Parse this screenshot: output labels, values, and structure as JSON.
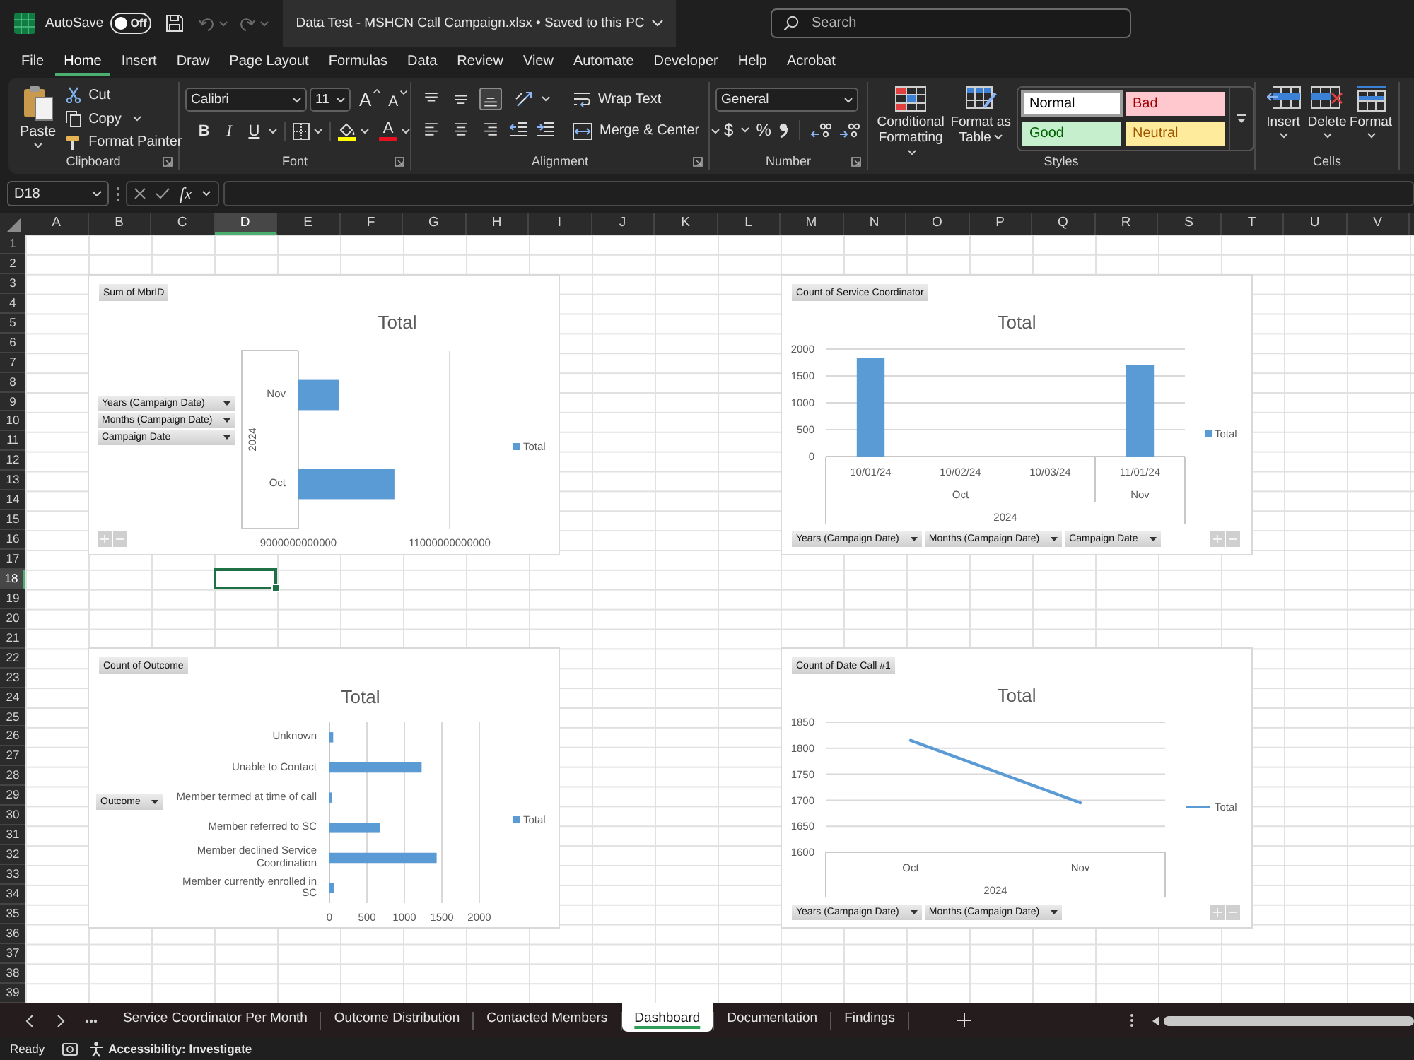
{
  "title_bar": {
    "autosave": {
      "label": "AutoSave",
      "state": "Off",
      "on": false
    },
    "undo": {
      "disabled": true
    },
    "redo": {
      "disabled": true
    },
    "document_title": "Data Test - MSHCN Call Campaign.xlsx • Saved to this PC",
    "search": {
      "placeholder": "Search"
    }
  },
  "menu_tabs": [
    {
      "label": "File",
      "selected": false
    },
    {
      "label": "Home",
      "selected": true
    },
    {
      "label": "Insert",
      "selected": false
    },
    {
      "label": "Draw",
      "selected": false
    },
    {
      "label": "Page Layout",
      "selected": false
    },
    {
      "label": "Formulas",
      "selected": false
    },
    {
      "label": "Data",
      "selected": false
    },
    {
      "label": "Review",
      "selected": false
    },
    {
      "label": "View",
      "selected": false
    },
    {
      "label": "Automate",
      "selected": false
    },
    {
      "label": "Developer",
      "selected": false
    },
    {
      "label": "Help",
      "selected": false
    },
    {
      "label": "Acrobat",
      "selected": false
    }
  ],
  "ribbon": {
    "clipboard": {
      "paste": "Paste",
      "cut": "Cut",
      "copy": "Copy",
      "format_painter": "Format Painter",
      "label": "Clipboard"
    },
    "font": {
      "font_name": "Calibri",
      "font_size": "11",
      "grow_font": "A",
      "shrink_font": "A",
      "bold": "B",
      "italic": "I",
      "underline": "U",
      "font_color": "A",
      "label": "Font"
    },
    "alignment": {
      "vertical": [
        {
          "kind": "top",
          "selected": false
        },
        {
          "kind": "middle",
          "selected": false
        },
        {
          "kind": "bottom",
          "selected": true
        }
      ],
      "horizontal": [
        {
          "kind": "left",
          "selected": false
        },
        {
          "kind": "center",
          "selected": false
        },
        {
          "kind": "right",
          "selected": false
        }
      ],
      "wrap_text": "Wrap Text",
      "merge_center": "Merge & Center",
      "label": "Alignment"
    },
    "number": {
      "format": "General",
      "currency": "$",
      "percent": "%",
      "label": "Number"
    },
    "styles": {
      "conditional_formatting": "Conditional Formatting",
      "format_as_table": "Format as Table",
      "cell_styles": [
        {
          "label": "Normal",
          "kind": "normal",
          "color": "#ffffff",
          "selected": true
        },
        {
          "label": "Bad",
          "kind": "bad",
          "color": "#ffc7ce",
          "selected": false
        },
        {
          "label": "Good",
          "kind": "good",
          "color": "#c6efce",
          "selected": false
        },
        {
          "label": "Neutral",
          "kind": "neutral",
          "color": "#ffeb9c",
          "selected": false
        }
      ],
      "label": "Styles"
    },
    "cells": {
      "buttons": [
        {
          "label": "Insert",
          "kind": "insert"
        },
        {
          "label": "Delete",
          "kind": "delete"
        },
        {
          "label": "Format",
          "kind": "format"
        }
      ],
      "label": "Cells"
    }
  },
  "formula_bar": {
    "name_box": "D18",
    "function_label": "fx"
  },
  "sheet": {
    "columns": [
      {
        "label": "A",
        "selected": false
      },
      {
        "label": "B",
        "selected": false
      },
      {
        "label": "C",
        "selected": false
      },
      {
        "label": "D",
        "selected": true
      },
      {
        "label": "E",
        "selected": false
      },
      {
        "label": "F",
        "selected": false
      },
      {
        "label": "G",
        "selected": false
      },
      {
        "label": "H",
        "selected": false
      },
      {
        "label": "I",
        "selected": false
      },
      {
        "label": "J",
        "selected": false
      },
      {
        "label": "K",
        "selected": false
      },
      {
        "label": "L",
        "selected": false
      },
      {
        "label": "M",
        "selected": false
      },
      {
        "label": "N",
        "selected": false
      },
      {
        "label": "O",
        "selected": false
      },
      {
        "label": "P",
        "selected": false
      },
      {
        "label": "Q",
        "selected": false
      },
      {
        "label": "R",
        "selected": false
      },
      {
        "label": "S",
        "selected": false
      },
      {
        "label": "T",
        "selected": false
      },
      {
        "label": "U",
        "selected": false
      },
      {
        "label": "V",
        "selected": false
      }
    ],
    "rows": [
      {
        "label": "1",
        "selected": false
      },
      {
        "label": "2",
        "selected": false
      },
      {
        "label": "3",
        "selected": false
      },
      {
        "label": "4",
        "selected": false
      },
      {
        "label": "5",
        "selected": false
      },
      {
        "label": "6",
        "selected": false
      },
      {
        "label": "7",
        "selected": false
      },
      {
        "label": "8",
        "selected": false
      },
      {
        "label": "9",
        "selected": false
      },
      {
        "label": "10",
        "selected": false
      },
      {
        "label": "11",
        "selected": false
      },
      {
        "label": "12",
        "selected": false
      },
      {
        "label": "13",
        "selected": false
      },
      {
        "label": "14",
        "selected": false
      },
      {
        "label": "15",
        "selected": false
      },
      {
        "label": "16",
        "selected": false
      },
      {
        "label": "17",
        "selected": false
      },
      {
        "label": "18",
        "selected": true
      },
      {
        "label": "19",
        "selected": false
      },
      {
        "label": "20",
        "selected": false
      },
      {
        "label": "21",
        "selected": false
      },
      {
        "label": "22",
        "selected": false
      },
      {
        "label": "23",
        "selected": false
      },
      {
        "label": "24",
        "selected": false
      },
      {
        "label": "25",
        "selected": false
      },
      {
        "label": "26",
        "selected": false
      },
      {
        "label": "27",
        "selected": false
      },
      {
        "label": "28",
        "selected": false
      },
      {
        "label": "29",
        "selected": false
      },
      {
        "label": "30",
        "selected": false
      },
      {
        "label": "31",
        "selected": false
      },
      {
        "label": "32",
        "selected": false
      },
      {
        "label": "33",
        "selected": false
      },
      {
        "label": "34",
        "selected": false
      },
      {
        "label": "35",
        "selected": false
      },
      {
        "label": "36",
        "selected": false
      },
      {
        "label": "37",
        "selected": false
      },
      {
        "label": "38",
        "selected": false
      },
      {
        "label": "39",
        "selected": false
      }
    ]
  },
  "charts": [
    {
      "value_button": "Sum of MbrID",
      "field_buttons": [
        "Years (Campaign Date)",
        "Months (Campaign Date)",
        "Campaign Date"
      ],
      "expand_collapse": true,
      "category_levels": [
        [
          "2024"
        ]
      ],
      "chart_data": {
        "type": "bar",
        "orientation": "horizontal",
        "title": "Total",
        "categories": [
          "Nov",
          "Oct"
        ],
        "series": [
          {
            "name": "Total",
            "color": "#5b9bd5",
            "values": [
              9540000000000,
              10270000000000
            ]
          }
        ],
        "xlim": [
          9000000000000,
          11000000000000
        ],
        "xticks": [
          9000000000000,
          11000000000000
        ],
        "grid": true
      }
    },
    {
      "value_button": "Count of Service Coordinator",
      "field_buttons": [
        "Years (Campaign Date)",
        "Months (Campaign Date)",
        "Campaign Date"
      ],
      "expand_collapse": true,
      "category_levels": [
        [
          "Oct",
          "Nov"
        ],
        [
          "2024"
        ]
      ],
      "chart_data": {
        "type": "bar",
        "orientation": "vertical",
        "title": "Total",
        "categories": [
          "10/01/24",
          "10/02/24",
          "10/03/24",
          "11/01/24"
        ],
        "series": [
          {
            "name": "Total",
            "color": "#5b9bd5",
            "values": [
              1840,
              null,
              null,
              1710
            ]
          }
        ],
        "ylim": [
          0,
          2000
        ],
        "yticks": [
          0,
          500,
          1000,
          1500,
          2000
        ],
        "grid": true
      }
    },
    {
      "value_button": "Count of Outcome",
      "field_buttons": [
        "Outcome"
      ],
      "expand_collapse": false,
      "chart_data": {
        "type": "bar",
        "orientation": "horizontal",
        "title": "Total",
        "categories": [
          "Unknown",
          "Unable to Contact",
          "Member termed at time of call",
          "Member referred to SC",
          "Member declined Service Coordination",
          "Member currently enrolled in SC"
        ],
        "series": [
          {
            "name": "Total",
            "color": "#5b9bd5",
            "values": [
              50,
              1230,
              30,
              670,
              1430,
              60
            ]
          }
        ],
        "xlim": [
          0,
          2000
        ],
        "xticks": [
          0,
          500,
          1000,
          1500,
          2000
        ],
        "grid": true
      }
    },
    {
      "value_button": "Count of Date Call #1",
      "field_buttons": [
        "Years (Campaign Date)",
        "Months (Campaign Date)"
      ],
      "expand_collapse": true,
      "category_levels": [
        [
          "2024"
        ]
      ],
      "chart_data": {
        "type": "line",
        "title": "Total",
        "categories": [
          "Oct",
          "Nov"
        ],
        "series": [
          {
            "name": "Total",
            "color": "#5b9bd5",
            "values": [
              1815,
              1695
            ]
          }
        ],
        "ylim": [
          1600,
          1850
        ],
        "yticks": [
          1600,
          1650,
          1700,
          1750,
          1800,
          1850
        ],
        "grid": true
      }
    }
  ],
  "sheet_tabs": [
    {
      "label": "Service Coordinator Per Month",
      "selected": false
    },
    {
      "label": "Outcome Distribution",
      "selected": false
    },
    {
      "label": "Contacted Members",
      "selected": false
    },
    {
      "label": "Dashboard",
      "selected": true
    },
    {
      "label": "Documentation",
      "selected": false
    },
    {
      "label": "Findings",
      "selected": false
    }
  ],
  "status_bar": {
    "mode": "Ready",
    "accessibility": "Accessibility: Investigate"
  }
}
